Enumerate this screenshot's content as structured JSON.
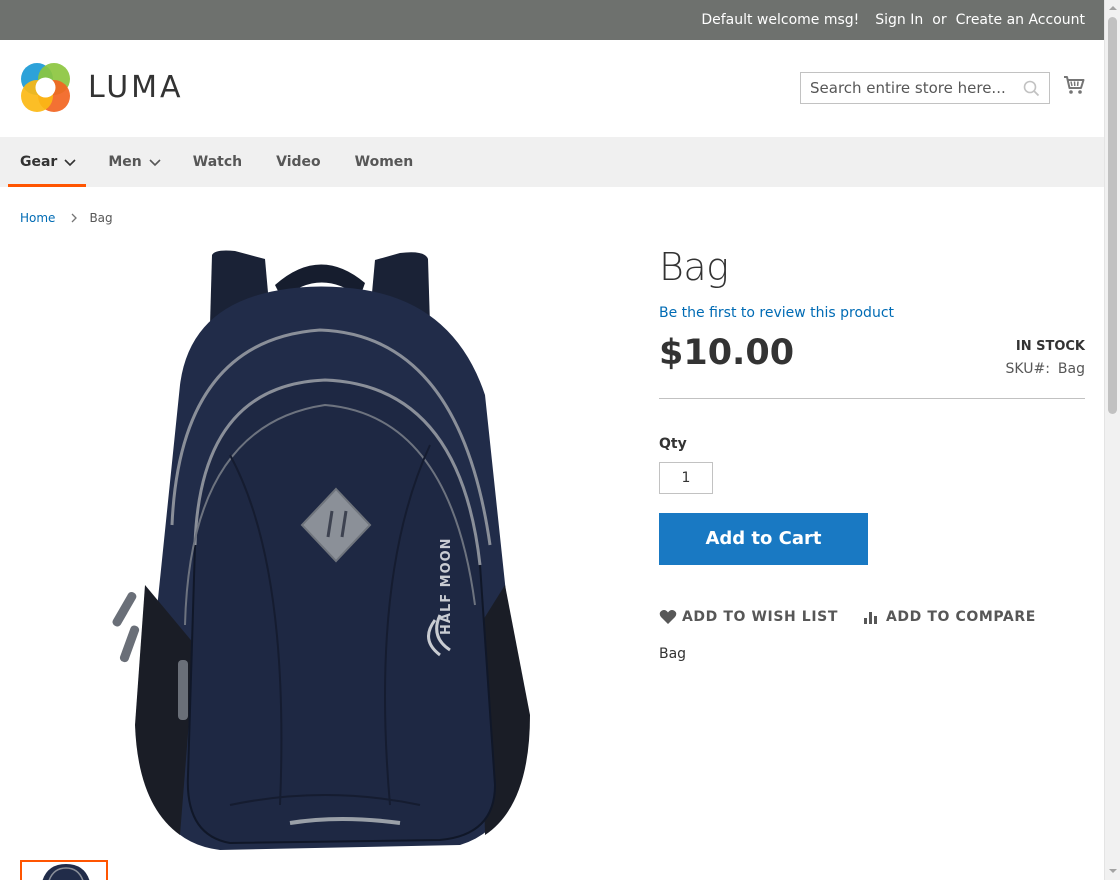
{
  "panel": {
    "welcome": "Default welcome msg!",
    "sign_in": "Sign In",
    "or": "or",
    "create_account": "Create an Account"
  },
  "header": {
    "logo_text": "LUMA",
    "search_placeholder": "Search entire store here...",
    "search_icon": "search-icon",
    "cart_icon": "cart-icon"
  },
  "nav": {
    "items": [
      {
        "label": "Gear",
        "has_submenu": true,
        "active": true
      },
      {
        "label": "Men",
        "has_submenu": true,
        "active": false
      },
      {
        "label": "Watch",
        "has_submenu": false,
        "active": false
      },
      {
        "label": "Video",
        "has_submenu": false,
        "active": false
      },
      {
        "label": "Women",
        "has_submenu": false,
        "active": false
      }
    ]
  },
  "breadcrumb": {
    "home": "Home",
    "current": "Bag"
  },
  "product": {
    "title": "Bag",
    "review_link": "Be the first to review this product",
    "price": "$10.00",
    "stock": "In stock",
    "sku_label": "SKU#:",
    "sku_value": "Bag",
    "qty_label": "Qty",
    "qty_value": "1",
    "add_to_cart": "Add to Cart",
    "wishlist": "Add to Wish List",
    "compare": "Add to Compare",
    "description": "Bag",
    "image_brand_text": "HALF MOON"
  },
  "colors": {
    "top_bar": "#6e716e",
    "nav_bg": "#f0f0f0",
    "accent_orange": "#ff5501",
    "primary_blue": "#1979c3",
    "link_blue": "#006bb4",
    "bag_navy": "#1f2a44"
  }
}
